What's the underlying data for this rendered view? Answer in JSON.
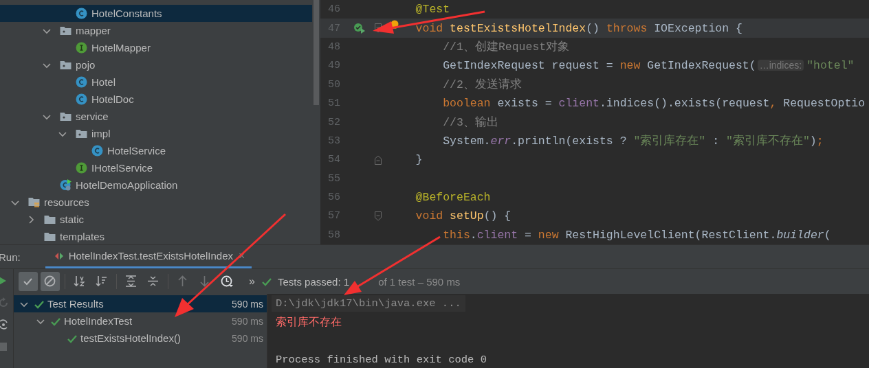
{
  "project_tree": [
    {
      "children": [
        {
          "children": [
            {
              "children": [
                {
                  "label": "HotelConstants",
                  "kind": "class",
                  "selected": true
                }
              ]
            },
            {
              "label": "mapper",
              "kind": "package",
              "expanded": true,
              "selected": false,
              "children": [
                {
                  "label": "HotelMapper",
                  "kind": "interface",
                  "selected": false
                }
              ]
            },
            {
              "label": "pojo",
              "kind": "package",
              "expanded": true,
              "selected": false,
              "children": [
                {
                  "label": "Hotel",
                  "kind": "class",
                  "selected": false
                },
                {
                  "label": "HotelDoc",
                  "kind": "class",
                  "selected": false
                }
              ]
            },
            {
              "label": "service",
              "kind": "package",
              "expanded": true,
              "selected": false,
              "children": [
                {
                  "label": "impl",
                  "kind": "package",
                  "expanded": true,
                  "selected": false,
                  "children": [
                    {
                      "label": "HotelService",
                      "kind": "class",
                      "selected": false
                    }
                  ]
                },
                {
                  "label": "IHotelService",
                  "kind": "interface",
                  "selected": false
                }
              ]
            },
            {
              "label": "HotelDemoApplication",
              "kind": "app",
              "selected": false
            }
          ]
        }
      ]
    },
    {
      "label": "resources",
      "kind": "resources",
      "expanded": true,
      "selected": false,
      "children": [
        {
          "label": "static",
          "kind": "folder",
          "expanded": false,
          "selected": false
        },
        {
          "label": "templates",
          "kind": "folder",
          "selected": false
        }
      ]
    }
  ],
  "editor": {
    "lines": [
      {
        "number": "46",
        "kind": "member",
        "current": false,
        "tokens": [
          {
            "kind": "annotation",
            "text": "@Test"
          }
        ]
      },
      {
        "number": "47",
        "kind": "member",
        "current": true,
        "run_marker": true,
        "fold_start": true,
        "intention_bulb": true,
        "tokens": [
          {
            "kind": "keyword",
            "text": "void "
          },
          {
            "kind": "method",
            "text": "testExistsHotelIndex"
          },
          {
            "kind": "plain",
            "text": "() "
          },
          {
            "kind": "keyword",
            "text": "throws "
          },
          {
            "kind": "plain",
            "text": "IOException {"
          }
        ]
      },
      {
        "number": "48",
        "kind": "statement",
        "current": false,
        "tokens": [
          {
            "kind": "comment",
            "text": "//1、创建Request对象"
          }
        ]
      },
      {
        "number": "49",
        "kind": "statement",
        "current": false,
        "tokens": [
          {
            "kind": "plain",
            "text": "GetIndexRequest request = "
          },
          {
            "kind": "keyword",
            "text": "new "
          },
          {
            "kind": "plain",
            "text": "GetIndexRequest("
          },
          {
            "kind": "hint",
            "text": "…indices:"
          },
          {
            "kind": "string",
            "text": "\"hotel\""
          }
        ]
      },
      {
        "number": "50",
        "kind": "statement",
        "current": false,
        "tokens": [
          {
            "kind": "comment",
            "text": "//2、发送请求"
          }
        ]
      },
      {
        "number": "51",
        "kind": "statement",
        "current": false,
        "tokens": [
          {
            "kind": "keyword",
            "text": "boolean "
          },
          {
            "kind": "plain",
            "text": "exists = "
          },
          {
            "kind": "field",
            "text": "client"
          },
          {
            "kind": "plain",
            "text": ".indices().exists(request"
          },
          {
            "kind": "punct",
            "text": ", "
          },
          {
            "kind": "plain",
            "text": "RequestOptio"
          }
        ]
      },
      {
        "number": "52",
        "kind": "statement",
        "current": false,
        "tokens": [
          {
            "kind": "comment",
            "text": "//3、输出"
          }
        ]
      },
      {
        "number": "53",
        "kind": "statement",
        "current": false,
        "tokens": [
          {
            "kind": "plain",
            "text": "System."
          },
          {
            "kind": "static",
            "text": "err"
          },
          {
            "kind": "plain",
            "text": ".println(exists ? "
          },
          {
            "kind": "string",
            "text": "\"索引库存在\""
          },
          {
            "kind": "plain",
            "text": " : "
          },
          {
            "kind": "string",
            "text": "\"索引库不存在\""
          },
          {
            "kind": "plain",
            "text": ")"
          },
          {
            "kind": "punct",
            "text": ";"
          }
        ]
      },
      {
        "number": "54",
        "kind": "member",
        "current": false,
        "fold_end": true,
        "tokens": [
          {
            "kind": "plain",
            "text": "}"
          }
        ]
      },
      {
        "number": "55",
        "kind": "blank",
        "current": false
      },
      {
        "number": "56",
        "kind": "member",
        "current": false,
        "tokens": [
          {
            "kind": "annotation",
            "text": "@BeforeEach"
          }
        ]
      },
      {
        "number": "57",
        "kind": "member",
        "current": false,
        "fold_start": true,
        "tokens": [
          {
            "kind": "keyword",
            "text": "void "
          },
          {
            "kind": "method",
            "text": "setUp"
          },
          {
            "kind": "plain",
            "text": "() {"
          }
        ]
      },
      {
        "number": "58",
        "kind": "statement",
        "current": false,
        "tokens": [
          {
            "kind": "keyword",
            "text": "this"
          },
          {
            "kind": "plain",
            "text": "."
          },
          {
            "kind": "field",
            "text": "client"
          },
          {
            "kind": "plain",
            "text": " = "
          },
          {
            "kind": "keyword",
            "text": "new "
          },
          {
            "kind": "plain",
            "text": "RestHighLevelClient(RestClient."
          },
          {
            "kind": "italic",
            "text": "builder"
          },
          {
            "kind": "plain",
            "text": "("
          }
        ]
      }
    ]
  },
  "run_panel": {
    "label": "Run:",
    "tabs": [
      {
        "label": "HotelIndexTest.testExistsHotelIndex",
        "close": "×",
        "selected": true
      }
    ],
    "side_buttons": [
      {
        "disabled": false
      },
      {
        "disabled": true
      },
      {
        "disabled": false
      },
      {
        "disabled": true
      }
    ],
    "toolbar": [
      {
        "kind": "toggle",
        "selected": true
      },
      {
        "kind": "toggle",
        "selected": true
      },
      {
        "kind": "separator"
      },
      {
        "kind": "button",
        "disabled": false
      },
      {
        "kind": "button",
        "disabled": false
      },
      {
        "kind": "separator"
      },
      {
        "kind": "button",
        "disabled": false
      },
      {
        "kind": "button",
        "disabled": false
      },
      {
        "kind": "separator"
      },
      {
        "kind": "button",
        "disabled": true
      },
      {
        "kind": "button",
        "disabled": true
      },
      {
        "kind": "button",
        "disabled": false
      }
    ],
    "more": "»",
    "status": {
      "passed": true,
      "summary": "Tests passed: 1",
      "detail": "of 1 test – 590 ms"
    },
    "test_tree": [
      {
        "label": "Test Results",
        "time": "590 ms",
        "passed": true,
        "expanded": true,
        "selected": true,
        "children": [
          {
            "label": "HotelIndexTest",
            "time": "590 ms",
            "passed": true,
            "expanded": true,
            "selected": false,
            "children": [
              {
                "label": "testExistsHotelIndex()",
                "time": "590 ms",
                "passed": true,
                "selected": false
              }
            ]
          }
        ]
      }
    ],
    "console": [
      {
        "kind": "command",
        "text": "D:\\jdk\\jdk17\\bin\\java.exe ..."
      },
      {
        "kind": "stderr",
        "text": "索引库不存在"
      },
      {
        "kind": "blank"
      },
      {
        "kind": "stdout",
        "text": "Process finished with exit code 0"
      }
    ]
  }
}
